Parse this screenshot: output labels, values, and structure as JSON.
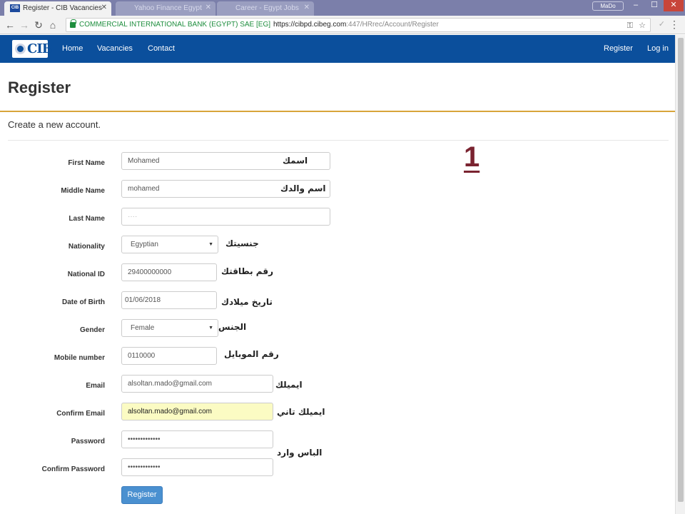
{
  "browser": {
    "active_tab": "Register - CIB Vacancies",
    "tab_logo": "CIB",
    "inactive_tabs": [
      "Yahoo Finance Egypt",
      "Career - Egypt Jobs"
    ],
    "profile": "MaDo",
    "omnibox": {
      "org": "COMMERCIAL INTERNATIONAL BANK (EGYPT) SAE [EG]",
      "url_host": "https://cibpd.cibeg.com",
      "url_path": ":447/HRrec/Account/Register"
    },
    "icons": [
      "back-icon",
      "forward-icon",
      "reload-icon",
      "home-icon",
      "lock-icon",
      "key-icon",
      "star-icon",
      "check-icon",
      "menu-icon"
    ]
  },
  "site": {
    "logo": "CIB",
    "nav": [
      "Home",
      "Vacancies",
      "Contact"
    ],
    "nav_right": [
      "Register",
      "Log in"
    ],
    "brand_color": "#0b4f9c"
  },
  "page": {
    "title": "Register",
    "subtitle": "Create a new account.",
    "step_number": "1"
  },
  "form": {
    "first_name": {
      "label": "First Name",
      "value": "Mohamed",
      "note": "اسمك"
    },
    "middle_name": {
      "label": "Middle Name",
      "value": "mohamed",
      "note": "اسم والدك"
    },
    "last_name": {
      "label": "Last Name",
      "value": "····"
    },
    "nationality": {
      "label": "Nationality",
      "value": "Egyptian",
      "note": "جنسيتك"
    },
    "national_id": {
      "label": "National ID",
      "value": "29400000000",
      "note": "رقم بطاقتك"
    },
    "dob": {
      "label": "Date of Birth",
      "value": "01/06/2018",
      "note": "تاريخ ميلادك"
    },
    "gender": {
      "label": "Gender",
      "value": "Female",
      "note": "الجنس"
    },
    "mobile": {
      "label": "Mobile number",
      "value": "0110000",
      "note": "رقم الموبايل"
    },
    "email": {
      "label": "Email",
      "value": "alsoltan.mado@gmail.com",
      "note": "ايميلك"
    },
    "confirm_email": {
      "label": "Confirm Email",
      "value": "alsoltan.mado@gmail.com",
      "note": "ايميلك تاني"
    },
    "password": {
      "label": "Password",
      "value": "•••••••••••••"
    },
    "confirm_password": {
      "label": "Confirm Password",
      "value": "•••••••••••••"
    },
    "password_note": "الباس وارد",
    "submit": "Register"
  }
}
